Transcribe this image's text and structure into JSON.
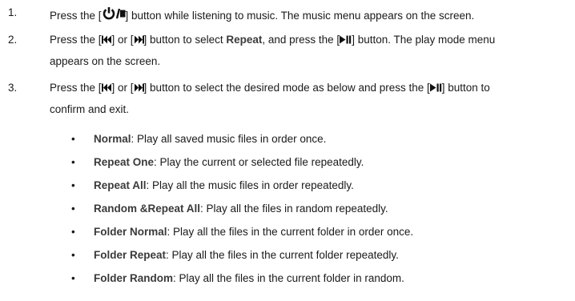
{
  "steps": [
    {
      "num": "1.",
      "pre": "Press the [",
      "post": "] button while listening to music. The music menu appears on the screen."
    },
    {
      "num": "2.",
      "a": "Press the [",
      "b": "] or [",
      "c": "] button to select ",
      "kw": "Repeat",
      "d": ", and press the [",
      "e": "] button. The play mode menu",
      "cont": "appears on the screen."
    },
    {
      "num": "3.",
      "a": "Press the [",
      "b": "] or [",
      "c": "] button to select the desired mode as below and press the [",
      "e": "] button to",
      "cont": "confirm and exit."
    }
  ],
  "modes": [
    {
      "name": "Normal",
      "desc": ": Play all saved music files in order once."
    },
    {
      "name": "Repeat One",
      "desc": ": Play the current or selected file repeatedly."
    },
    {
      "name": "Repeat All",
      "desc": ": Play all the music files in order repeatedly."
    },
    {
      "name": "Random &Repeat All",
      "desc": ": Play all the files in random repeatedly."
    },
    {
      "name": "Folder Normal",
      "desc": ": Play all the files in the current folder in order once."
    },
    {
      "name": "Folder Repeat",
      "desc": ": Play all the files in the current folder repeatedly."
    },
    {
      "name": "Folder Random",
      "desc": ": Play all the files in the current folder in random."
    }
  ],
  "bullet_char": "•",
  "icons": [
    "power-stop-icon",
    "previous-icon",
    "next-icon",
    "play-pause-icon"
  ]
}
